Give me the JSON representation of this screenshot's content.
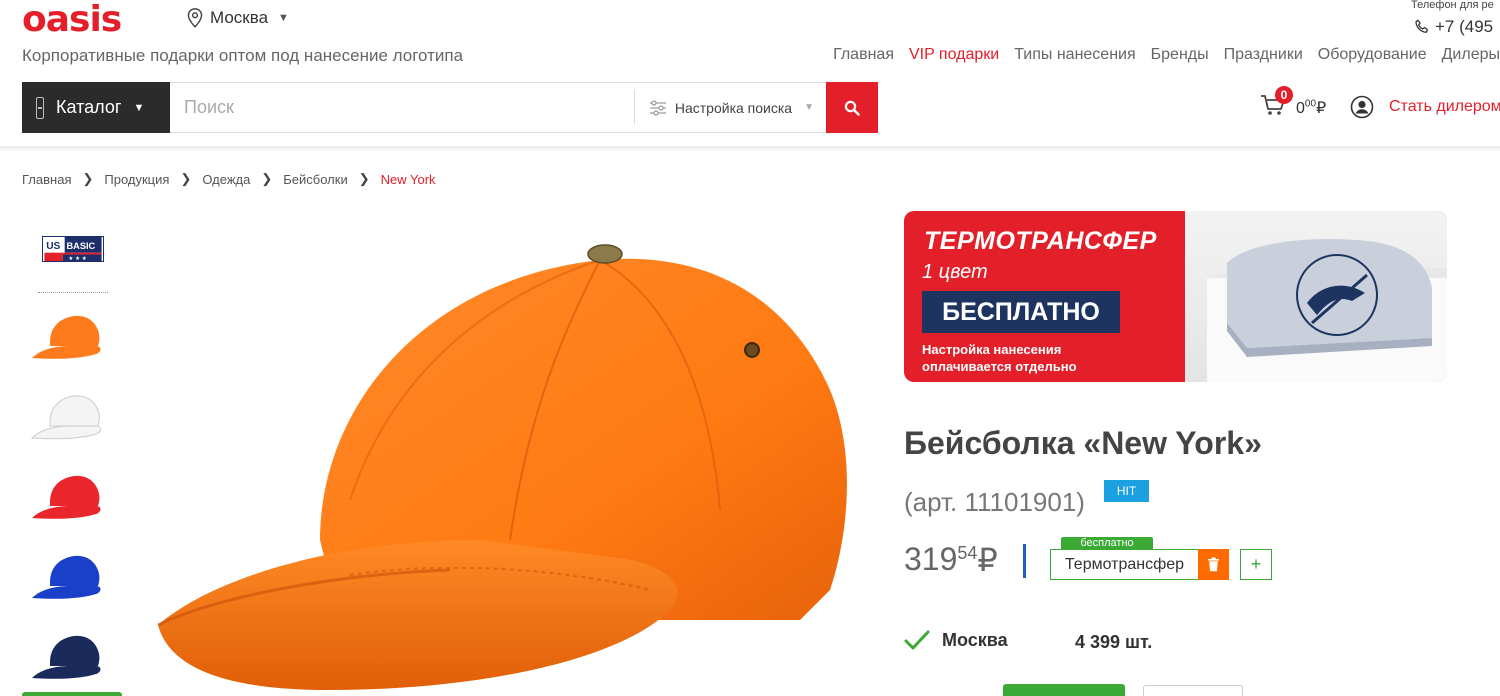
{
  "header": {
    "logo": "oasis",
    "city": "Москва",
    "tagline": "Корпоративные подарки оптом под нанесение логотипа",
    "phone_label": "Телефон для ре",
    "phone": "+7 (495",
    "nav": [
      {
        "label": "Главная"
      },
      {
        "label": "VIP подарки"
      },
      {
        "label": "Типы нанесения"
      },
      {
        "label": "Бренды"
      },
      {
        "label": "Праздники"
      },
      {
        "label": "Оборудование"
      },
      {
        "label": "Дилеры"
      }
    ]
  },
  "search": {
    "catalog_label": "Каталог",
    "placeholder": "Поиск",
    "settings_label": "Настройка поиска"
  },
  "cart": {
    "count": "0",
    "total_main": "0",
    "total_cents": "00",
    "currency": "₽"
  },
  "user": {
    "dealer_link": "Стать дилером"
  },
  "breadcrumb": [
    "Главная",
    "Продукция",
    "Одежда",
    "Бейсболки",
    "New York"
  ],
  "gallery": {
    "brand": "US BASIC",
    "thumb_colors": [
      "#ff7a1a",
      "#f4f4f4",
      "#e8262b",
      "#1a3fc8",
      "#1a2a5a"
    ],
    "main_color": "#ff7a1a"
  },
  "promo": {
    "title": "ТЕРМОТРАНСФЕР",
    "subtitle": "1 цвет",
    "badge": "БЕСПЛАТНО",
    "note": "Настройка нанесения оплачивается отдельно"
  },
  "product": {
    "title": "Бейсболка «New York»",
    "article": "(арт. 11101901)",
    "badge": "HIT",
    "price_main": "319",
    "price_cents": "54",
    "currency": "₽",
    "method_tag": "бесплатно",
    "method_label": "Термотрансфер",
    "add_method": "+"
  },
  "stock": {
    "city": "Москва",
    "quantity": "4 399 шт."
  },
  "colors": {
    "brand_red": "#e3202a",
    "accent_green": "#3aaa35",
    "hit_blue": "#1ba0e0",
    "trash_orange": "#ff6a00"
  }
}
